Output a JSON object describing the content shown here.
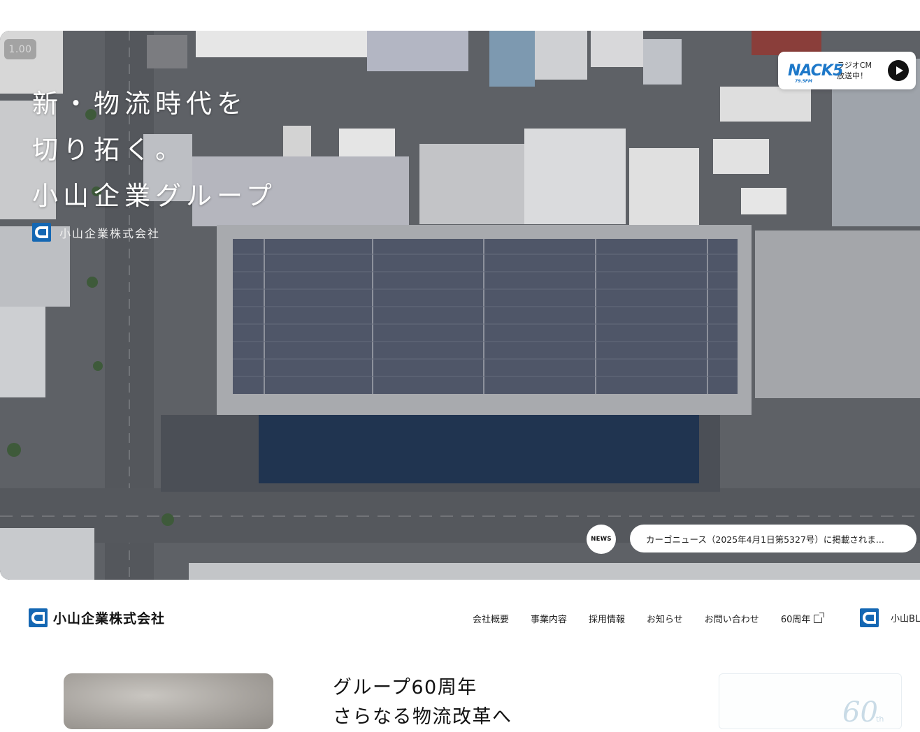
{
  "hero": {
    "speed_badge": "1.00",
    "headline": [
      "新・物流時代を",
      "切り拓く。",
      "小山企業グループ"
    ],
    "company_name": "小山企業株式会社"
  },
  "radio_cm": {
    "logo_text": "NACK5",
    "logo_sub": "79.5FM",
    "line1": "ラジオCM",
    "line2": "放送中！"
  },
  "news": {
    "badge": "NEWS",
    "headline": "カーゴニュース（2025年4月1日第5327号）に掲載されま..."
  },
  "header": {
    "brand": "小山企業株式会社",
    "nav": [
      {
        "label": "会社概要"
      },
      {
        "label": "事業内容"
      },
      {
        "label": "採用情報"
      },
      {
        "label": "お知らせ"
      },
      {
        "label": "お問い合わせ"
      },
      {
        "label": "60周年"
      }
    ],
    "blog_label": "小山BL"
  },
  "feature": {
    "title_lines": [
      "グループ60周年",
      "さらなる物流改革へ"
    ]
  },
  "anniversary_card": {
    "number": "60",
    "suffix": "th"
  },
  "colors": {
    "brand_blue": "#1467b3",
    "nack_blue": "#1d78c9"
  }
}
